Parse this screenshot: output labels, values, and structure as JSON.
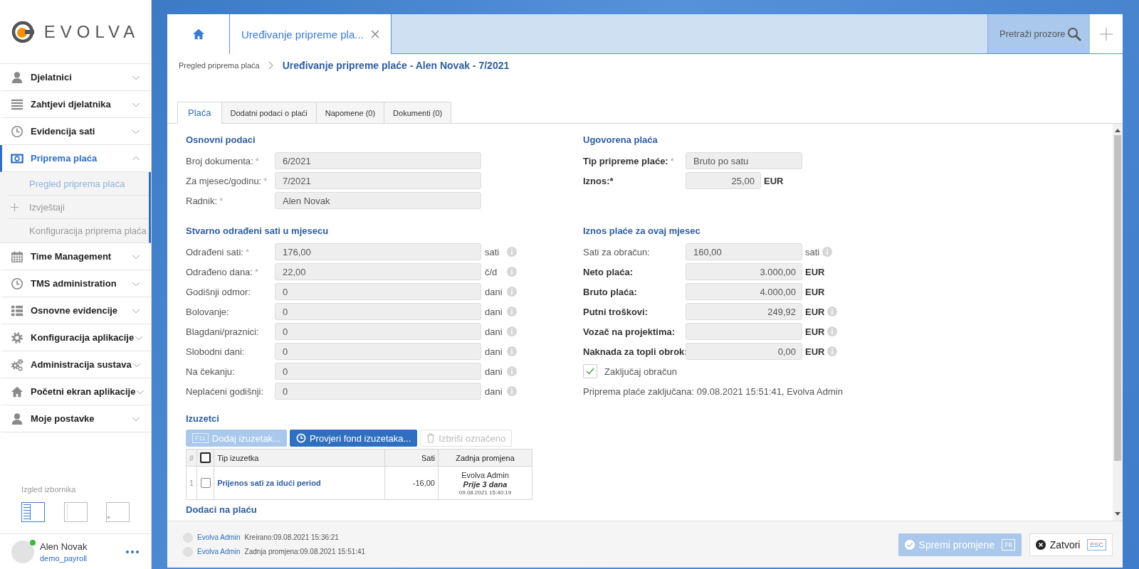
{
  "sidebar": {
    "logo": "EVOLVA",
    "menu": [
      {
        "label": "Djelatnici",
        "selected": false,
        "expanded": false
      },
      {
        "label": "Zahtjevi djelatnika",
        "selected": false,
        "expanded": false
      },
      {
        "label": "Evidencija sati",
        "selected": false,
        "expanded": false
      },
      {
        "label": "Priprema plaća",
        "selected": true,
        "expanded": true,
        "children": [
          {
            "label": "Pregled priprema plaća",
            "selected": true,
            "expandable": false
          },
          {
            "label": "Izvještaji",
            "selected": false,
            "expandable": true
          },
          {
            "label": "Konfiguracija priprema plaća",
            "selected": false,
            "expandable": false
          }
        ]
      },
      {
        "label": "Time Management",
        "selected": false,
        "expanded": false
      },
      {
        "label": "TMS administration",
        "selected": false,
        "expanded": false
      },
      {
        "label": "Osnovne evidencije",
        "selected": false,
        "expanded": false
      },
      {
        "label": "Konfiguracija aplikacije",
        "selected": false,
        "expanded": false
      },
      {
        "label": "Administracija sustava",
        "selected": false,
        "expanded": false
      },
      {
        "label": "Početni ekran aplikacije",
        "selected": false,
        "expanded": false
      },
      {
        "label": "Moje postavke",
        "selected": false,
        "expanded": false
      }
    ],
    "layout_label": "Izgled izbornika",
    "layout_options": [
      {
        "selected": true
      },
      {
        "selected": false
      },
      {
        "selected": false
      }
    ],
    "user": {
      "name": "Alen Novak",
      "username": "demo_payroll",
      "online": true
    }
  },
  "tab_bar": {
    "document_tab": {
      "title": "Uređivanje pripreme pla..."
    },
    "search_label": "Pretraži prozore"
  },
  "breadcrumb": {
    "parent": "Pregled priprema plaća",
    "current": "Uređivanje pripreme plaće - Alen Novak - 7/2021"
  },
  "tabs": [
    {
      "label": "Plaća",
      "selected": true
    },
    {
      "label": "Dodatni podaci o plaći",
      "selected": false
    },
    {
      "label": "Napomene (0)",
      "selected": false
    },
    {
      "label": "Dokumenti (0)",
      "selected": false
    }
  ],
  "basic_data": {
    "title": "Osnovni podaci",
    "fields": [
      {
        "label": "Broj dokumenta:",
        "mark": "*",
        "value": "6/2021",
        "info": false
      },
      {
        "label": "Za mjesec/godinu:",
        "mark": "*",
        "value": "7/2021",
        "info": false
      },
      {
        "label": "Radnik:",
        "mark": "*",
        "value": "Alen Novak",
        "info": false
      }
    ]
  },
  "contracted_pay": {
    "title": "Ugovorena plaća",
    "fields": [
      {
        "label": "Tip pripreme plaće:",
        "mark": "*",
        "value": "Bruto po satu",
        "kind": "text",
        "bold": true,
        "info": false
      },
      {
        "label": "Iznos:*",
        "value": "25,00",
        "unit": "EUR",
        "kind": "rate",
        "bold": true,
        "info": false
      }
    ]
  },
  "worked_hours": {
    "title": "Stvarno odrađeni sati u mjesecu",
    "fields": [
      {
        "label": "Odrađeni sati:",
        "mark": "*",
        "value": "176,00",
        "unit": "sati",
        "info": true
      },
      {
        "label": "Odrađeno dana:",
        "mark": "*",
        "value": "22,00",
        "unit": "č/d",
        "info": true
      },
      {
        "label": "Godišnji odmor:",
        "value": "0",
        "unit": "dani",
        "info": true
      },
      {
        "label": "Bolovanje:",
        "value": "0",
        "unit": "dani",
        "info": true
      },
      {
        "label": "Blagdani/praznici:",
        "value": "0",
        "unit": "dani",
        "info": true
      },
      {
        "label": "Slobodni dani:",
        "value": "0",
        "unit": "dani",
        "info": true
      },
      {
        "label": "Na čekanju:",
        "value": "0",
        "unit": "dani",
        "info": true
      },
      {
        "label": "Neplaćeni godišnji:",
        "value": "0",
        "unit": "dani",
        "info": true
      }
    ]
  },
  "monthly_pay": {
    "title": "Iznos plaće za ovaj mjesec",
    "fields": [
      {
        "label": "Sati za obračun:",
        "value": "160,00",
        "unit": "sati",
        "kind": "text",
        "bold": false,
        "info": true
      },
      {
        "label": "Neto plaća:",
        "value": "3.000,00",
        "unit": "EUR",
        "kind": "amount",
        "bold": true,
        "info": false
      },
      {
        "label": "Bruto plaća:",
        "value": "4.000,00",
        "unit": "EUR",
        "kind": "amount",
        "bold": true,
        "info": false
      },
      {
        "label": "Putni troškovi:",
        "value": "249,92",
        "unit": "EUR",
        "kind": "amount",
        "bold": true,
        "info": true
      },
      {
        "label": "Vozač na projektima:",
        "unit": "EUR",
        "kind": "amount",
        "bold": true,
        "info": true
      },
      {
        "label": "Naknada za topli obrok:",
        "value": "0,00",
        "unit": "EUR",
        "kind": "amount",
        "bold": true,
        "info": true
      }
    ],
    "lock": {
      "label": "Zaključaj obračun",
      "checked": true
    },
    "lock_note": "Priprema plaće zaključana: 09.08.2021 15:51:41, Evolva Admin"
  },
  "exceptions": {
    "title": "Izuzetci",
    "buttons": [
      {
        "label": "Dodaj izuzetak...",
        "shortcut": "F11",
        "kind": "primary",
        "disabled": true
      },
      {
        "label": "Provjeri fond izuzetaka...",
        "kind": "check",
        "disabled": false
      },
      {
        "label": "Izbriši označeno",
        "kind": "delete",
        "disabled": true
      }
    ],
    "columns": [
      "#",
      "Tip izuzetka",
      "Sati",
      "Zadnja promjena"
    ],
    "select_all_checked": false,
    "rows": [
      {
        "number": "1",
        "checked": false,
        "type": "Prijenos sati za idući period",
        "hours": "-16,00",
        "changed_by": "Evolva Admin",
        "changed_ago": "Prije 3 dana",
        "changed_at": "09.08.2021 15:40:19"
      }
    ]
  },
  "allowances": {
    "title": "Dodaci na plaću"
  },
  "footer": {
    "audit": [
      {
        "user": "Evolva Admin",
        "text": "Kreirano:09.08.2021 15:36:21"
      },
      {
        "user": "Evolva Admin",
        "text": "Zadnja promjena:09.08.2021 15:51:41"
      }
    ],
    "buttons": [
      {
        "label": "Spremi promjene",
        "shortcut": "F8",
        "kind": "save",
        "disabled": true
      },
      {
        "label": "Zatvori",
        "shortcut": "ESC",
        "kind": "close",
        "disabled": false
      }
    ]
  }
}
